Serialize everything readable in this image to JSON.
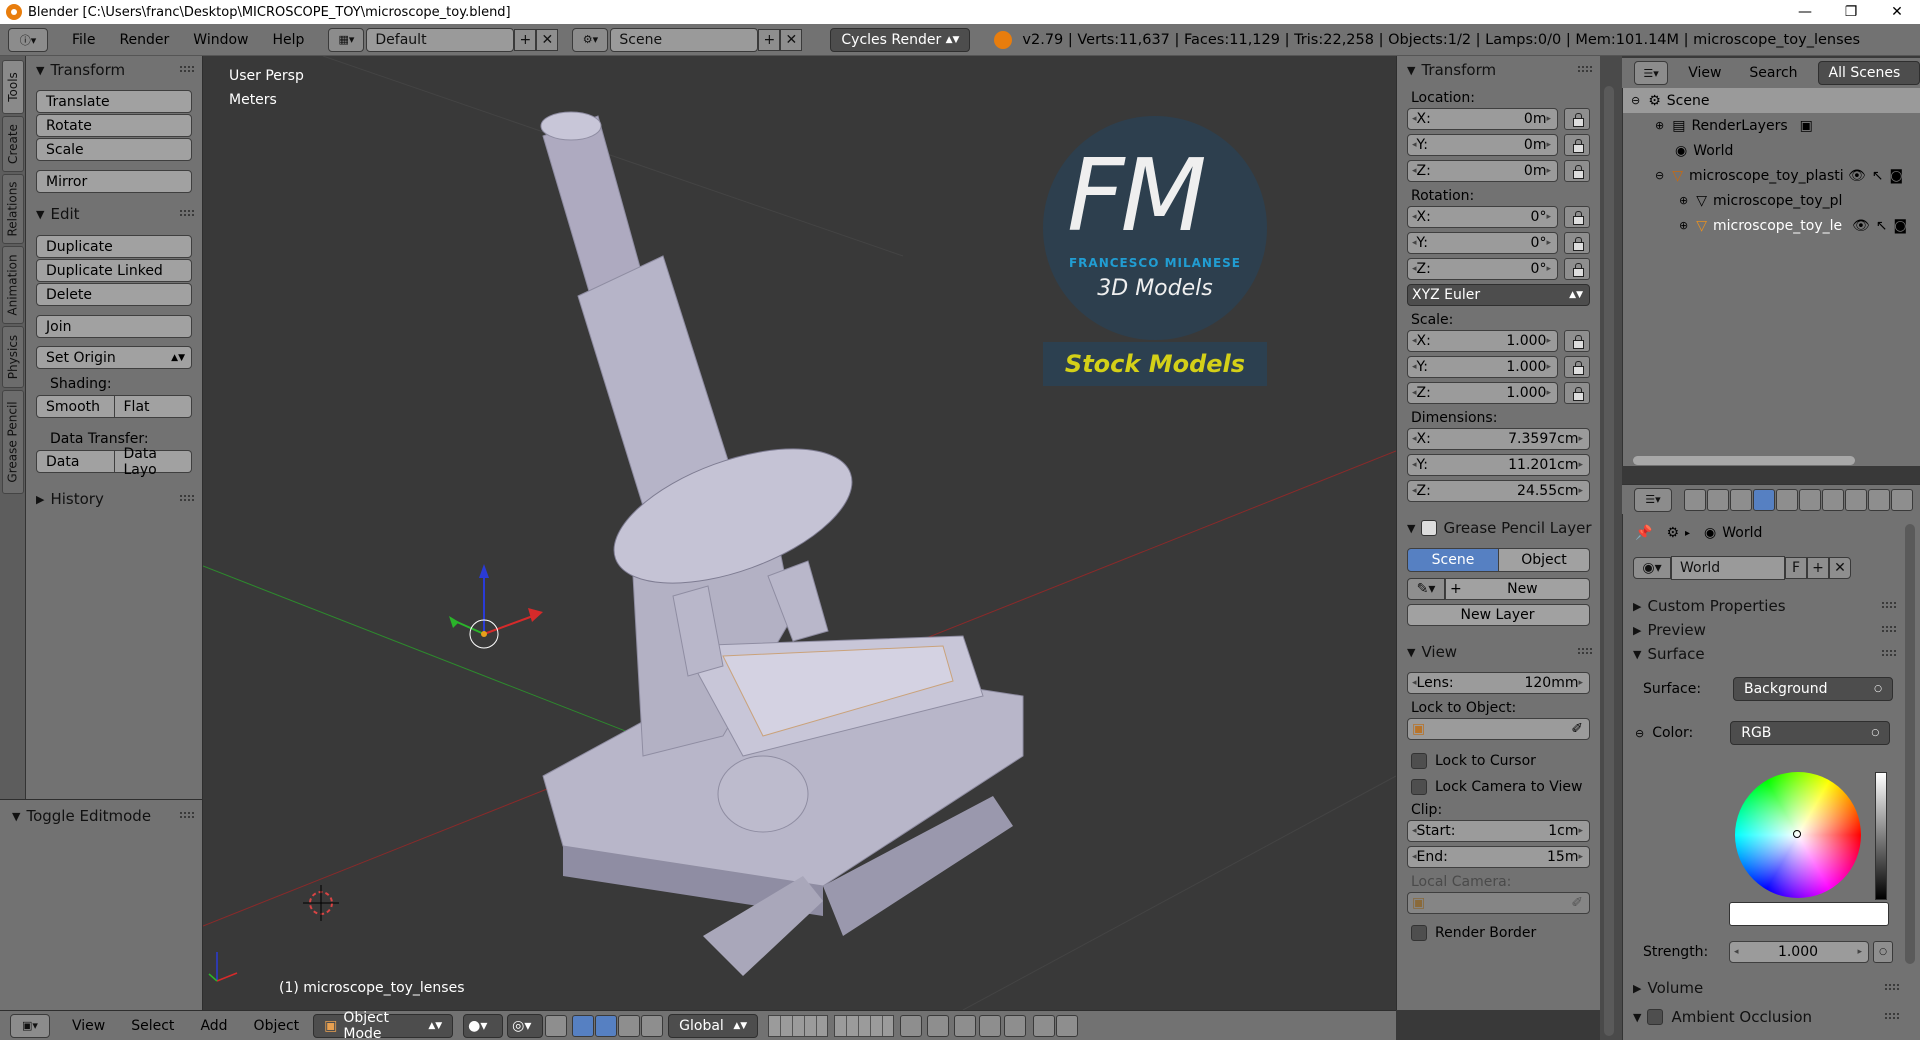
{
  "window": {
    "title": "Blender [C:\\Users\\franc\\Desktop\\MICROSCOPE_TOY\\microscope_toy.blend]",
    "controls": [
      "—",
      "❐",
      "✕"
    ]
  },
  "info_header": {
    "menus": [
      "File",
      "Render",
      "Window",
      "Help"
    ],
    "layout": "Default",
    "scene": "Scene",
    "engine": "Cycles Render",
    "stats": "v2.79 | Verts:11,637 | Faces:11,129 | Tris:22,258 | Objects:1/2 | Lamps:0/0 | Mem:101.14M | microscope_toy_lenses"
  },
  "left_tabs": [
    "Tools",
    "Create",
    "Relations",
    "Animation",
    "Physics",
    "Grease Pencil"
  ],
  "tool_shelf": {
    "transform": {
      "title": "Transform",
      "buttons": [
        "Translate",
        "Rotate",
        "Scale",
        "Mirror"
      ]
    },
    "edit": {
      "title": "Edit",
      "buttons": [
        "Duplicate",
        "Duplicate Linked",
        "Delete",
        "Join"
      ],
      "set_origin": "Set Origin",
      "shading_label": "Shading:",
      "shading": [
        "Smooth",
        "Flat"
      ],
      "data_transfer_label": "Data Transfer:",
      "data_transfer": [
        "Data",
        "Data Layo"
      ]
    },
    "history": "History",
    "toggle_editmode": "Toggle Editmode"
  },
  "viewport": {
    "view_name": "User Persp",
    "units": "Meters",
    "object_info": "(1) microscope_toy_lenses",
    "watermark": {
      "letters": "FM",
      "name": "FRANCESCO MILANESE",
      "sub": "3D Models",
      "banner": "Stock Models"
    }
  },
  "n_panel": {
    "transform_title": "Transform",
    "location_label": "Location:",
    "location": [
      {
        "axis": "X:",
        "value": "0m"
      },
      {
        "axis": "Y:",
        "value": "0m"
      },
      {
        "axis": "Z:",
        "value": "0m"
      }
    ],
    "rotation_label": "Rotation:",
    "rotation": [
      {
        "axis": "X:",
        "value": "0°"
      },
      {
        "axis": "Y:",
        "value": "0°"
      },
      {
        "axis": "Z:",
        "value": "0°"
      }
    ],
    "rotation_mode": "XYZ Euler",
    "scale_label": "Scale:",
    "scale": [
      {
        "axis": "X:",
        "value": "1.000"
      },
      {
        "axis": "Y:",
        "value": "1.000"
      },
      {
        "axis": "Z:",
        "value": "1.000"
      }
    ],
    "dimensions_label": "Dimensions:",
    "dimensions": [
      {
        "axis": "X:",
        "value": "7.3597cm"
      },
      {
        "axis": "Y:",
        "value": "11.201cm"
      },
      {
        "axis": "Z:",
        "value": "24.55cm"
      }
    ],
    "grease_title": "Grease Pencil Layer",
    "grease_tabs": [
      "Scene",
      "Object"
    ],
    "grease_new": "New",
    "grease_new_layer": "New Layer",
    "view_title": "View",
    "lens_label": "Lens:",
    "lens": "120mm",
    "lock_object_label": "Lock to Object:",
    "lock_cursor": "Lock to Cursor",
    "lock_camera": "Lock Camera to View",
    "clip_label": "Clip:",
    "clip_start_label": "Start:",
    "clip_start": "1cm",
    "clip_end_label": "End:",
    "clip_end": "15m",
    "local_camera": "Local Camera:",
    "render_border": "Render Border"
  },
  "outliner": {
    "header": [
      "View",
      "Search",
      "All Scenes"
    ],
    "items": [
      {
        "label": "Scene",
        "indent": 0,
        "icon": "scene-icon"
      },
      {
        "label": "RenderLayers",
        "indent": 1,
        "icon": "renderlayers-icon"
      },
      {
        "label": "World",
        "indent": 1,
        "icon": "world-icon"
      },
      {
        "label": "microscope_toy_plastic",
        "indent": 1,
        "icon": "object-icon"
      },
      {
        "label": "microscope_toy_pl",
        "indent": 2,
        "icon": "mesh-icon"
      },
      {
        "label": "microscope_toy_le",
        "indent": 2,
        "icon": "object-icon"
      }
    ]
  },
  "properties": {
    "context": "World",
    "datablock": "World",
    "datablock_flag": "F",
    "panels": [
      "Custom Properties",
      "Preview",
      "Surface"
    ],
    "surface_label": "Surface:",
    "surface_value": "Background",
    "color_label": "Color:",
    "color_value": "RGB",
    "strength_label": "Strength:",
    "strength": "1.000",
    "volume": "Volume",
    "ambient_occlusion": "Ambient Occlusion"
  },
  "bottom_header": {
    "menus": [
      "View",
      "Select",
      "Add",
      "Object"
    ],
    "mode": "Object Mode",
    "orientation": "Global"
  }
}
